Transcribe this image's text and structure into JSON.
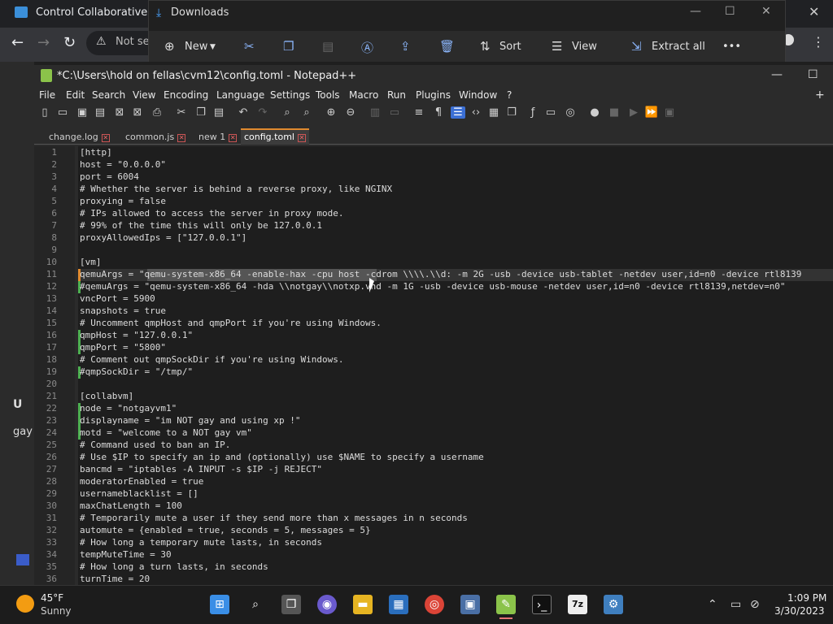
{
  "browser": {
    "title": "Control Collaborative Virtu",
    "omnibox_text": "Not se",
    "back_icon": "arrow-left-icon",
    "forward_icon": "arrow-right-icon",
    "reload_icon": "reload-icon",
    "close_glyph": "✕",
    "menu_glyph": "⋮",
    "side_user": "U",
    "side_text": "gay"
  },
  "downloads": {
    "title": "Downloads",
    "toolbar": {
      "new": "New",
      "sort": "Sort",
      "view": "View",
      "extract_all": "Extract all",
      "more": "•••"
    }
  },
  "notepad": {
    "title": "*C:\\Users\\hold on fellas\\cvm12\\config.toml - Notepad++",
    "menu": [
      "File",
      "Edit",
      "Search",
      "View",
      "Encoding",
      "Language",
      "Settings",
      "Tools",
      "Macro",
      "Run",
      "Plugins",
      "Window",
      "?"
    ],
    "tabs": [
      {
        "label": "change.log"
      },
      {
        "label": "common.js"
      },
      {
        "label": "new 1"
      },
      {
        "label": "config.toml",
        "active": true
      }
    ],
    "lines": [
      "[http]",
      "host = \"0.0.0.0\"",
      "port = 6004",
      "# Whether the server is behind a reverse proxy, like NGINX",
      "proxying = false",
      "# IPs allowed to access the server in proxy mode.",
      "# 99% of the time this will only be 127.0.0.1",
      "proxyAllowedIps = [\"127.0.0.1\"]",
      "",
      "[vm]",
      "qemuArgs = \"qemu-system-x86_64 -enable-hax -cpu host -cdrom \\\\\\\\.\\\\d: -m 2G -usb -device usb-tablet -netdev user,id=n0 -device rtl8139",
      "#qemuArgs = \"qemu-system-x86_64 -hda \\\\notgay\\\\notxp.vhd -m 1G -usb -device usb-mouse -netdev user,id=n0 -device rtl8139,netdev=n0\"",
      "vncPort = 5900",
      "snapshots = true",
      "# Uncomment qmpHost and qmpPort if you're using Windows.",
      "qmpHost = \"127.0.0.1\"",
      "qmpPort = \"5800\"",
      "# Comment out qmpSockDir if you're using Windows.",
      "#qmpSockDir = \"/tmp/\"",
      "",
      "[collabvm]",
      "node = \"notgayvm1\"",
      "displayname = \"im NOT gay and using xp !\"",
      "motd = \"welcome to a NOT gay vm\"",
      "# Command used to ban an IP.",
      "# Use $IP to specify an ip and (optionally) use $NAME to specify a username",
      "bancmd = \"iptables -A INPUT -s $IP -j REJECT\"",
      "moderatorEnabled = true",
      "usernameblacklist = []",
      "maxChatLength = 100",
      "# Temporarily mute a user if they send more than x messages in n seconds",
      "automute = {enabled = true, seconds = 5, messages = 5}",
      "# How long a temporary mute lasts, in seconds",
      "tempMuteTime = 30",
      "# How long a turn lasts, in seconds",
      "turnTime = 20"
    ]
  },
  "taskbar": {
    "temp": "45°F",
    "weather": "Sunny",
    "time": "1:09 PM",
    "date": "3/30/2023"
  },
  "colors": {
    "accent": "#3b6fd4",
    "modified_marker": "#4caf50",
    "tab_active_border": "#e08a2e"
  }
}
